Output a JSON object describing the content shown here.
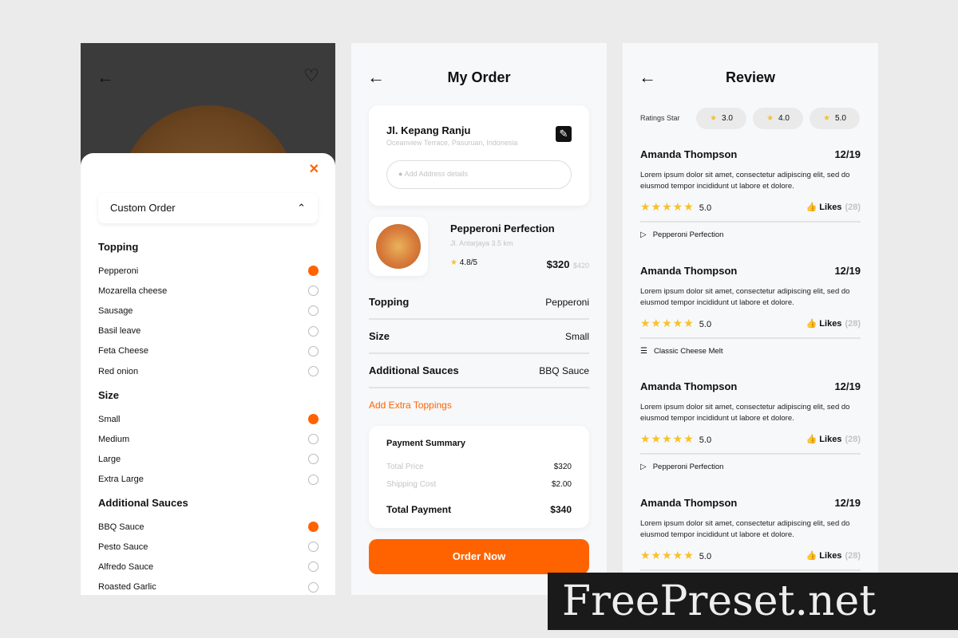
{
  "custom": {
    "title": "Custom Order",
    "groups": [
      {
        "title": "Topping",
        "options": [
          {
            "label": "Pepperoni",
            "selected": true
          },
          {
            "label": "Mozarella cheese",
            "selected": false
          },
          {
            "label": "Sausage",
            "selected": false
          },
          {
            "label": "Basil leave",
            "selected": false
          },
          {
            "label": "Feta Cheese",
            "selected": false
          },
          {
            "label": "Red onion",
            "selected": false
          }
        ]
      },
      {
        "title": "Size",
        "options": [
          {
            "label": "Small",
            "selected": true
          },
          {
            "label": "Medium",
            "selected": false
          },
          {
            "label": "Large",
            "selected": false
          },
          {
            "label": "Extra Large",
            "selected": false
          }
        ]
      },
      {
        "title": "Additional Sauces",
        "options": [
          {
            "label": "BBQ Sauce",
            "selected": true
          },
          {
            "label": "Pesto Sauce",
            "selected": false
          },
          {
            "label": "Alfredo Sauce",
            "selected": false
          },
          {
            "label": "Roasted Garlic",
            "selected": false
          }
        ]
      }
    ]
  },
  "order": {
    "title": "My Order",
    "address": {
      "street": "Jl. Kepang Ranju",
      "area": "Oceanview Terrace, Pasuruan, Indonesia",
      "placeholder": "Add Address details"
    },
    "product": {
      "name": "Pepperoni Perfection",
      "location": "Jl. Antarjaya 3.5 km",
      "rating": "4.8/5",
      "price": "$320",
      "old_price": "$420"
    },
    "rows": [
      {
        "label": "Topping",
        "value": "Pepperoni"
      },
      {
        "label": "Size",
        "value": "Small"
      },
      {
        "label": "Additional Sauces",
        "value": "BBQ Sauce"
      }
    ],
    "extra": "Add Extra Toppings",
    "summary": {
      "title": "Payment Summary",
      "total_price_label": "Total Price",
      "total_price": "$320",
      "shipping_label": "Shipping Cost",
      "shipping": "$2.00",
      "total_label": "Total Payment",
      "total": "$340"
    },
    "cta": "Order Now"
  },
  "review": {
    "title": "Review",
    "filter_label": "Ratings Star",
    "chips": [
      "3.0",
      "4.0",
      "5.0"
    ],
    "items": [
      {
        "name": "Amanda Thompson",
        "date": "12/19",
        "text": "Lorem ipsum dolor sit amet, consectetur adipiscing elit, sed do eiusmod tempor incididunt ut labore et dolore.",
        "rating": "5.0",
        "likes_label": "Likes",
        "likes": "(28)",
        "product": "Pepperoni Perfection",
        "product_icon": "pizza-slice-icon"
      },
      {
        "name": "Amanda Thompson",
        "date": "12/19",
        "text": "Lorem ipsum dolor sit amet, consectetur adipiscing elit, sed do eiusmod tempor incididunt ut labore et dolore.",
        "rating": "5.0",
        "likes_label": "Likes",
        "likes": "(28)",
        "product": "Classic Cheese Melt",
        "product_icon": "burger-icon"
      },
      {
        "name": "Amanda Thompson",
        "date": "12/19",
        "text": "Lorem ipsum dolor sit amet, consectetur adipiscing elit, sed do eiusmod tempor incididunt ut labore et dolore.",
        "rating": "5.0",
        "likes_label": "Likes",
        "likes": "(28)",
        "product": "Pepperoni Perfection",
        "product_icon": "pizza-slice-icon"
      },
      {
        "name": "Amanda Thompson",
        "date": "12/19",
        "text": "Lorem ipsum dolor sit amet, consectetur adipiscing elit, sed do eiusmod tempor incididunt ut labore et dolore.",
        "rating": "5.0",
        "likes_label": "Likes",
        "likes": "(28)"
      }
    ]
  },
  "watermark": "FreePreset.net",
  "colors": {
    "accent": "#ff6300",
    "star": "#f7c12b"
  }
}
